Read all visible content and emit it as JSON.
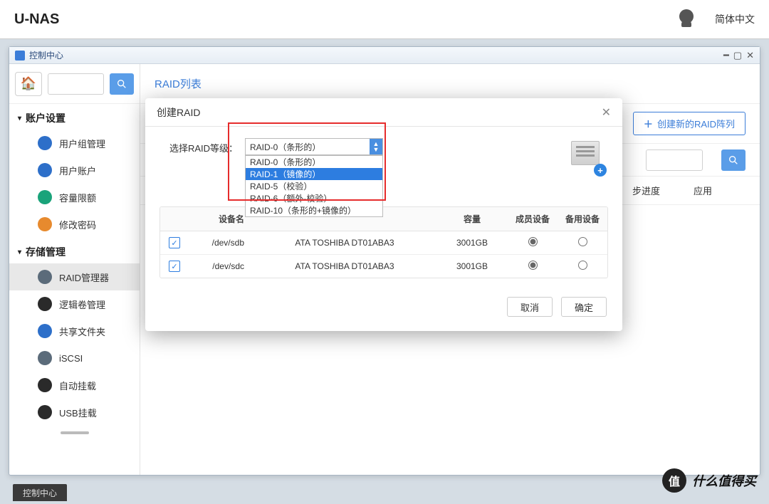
{
  "topbar": {
    "brand": "U-NAS",
    "language": "简体中文"
  },
  "window": {
    "title": "控制中心"
  },
  "sidebar": {
    "groups": [
      {
        "title": "账户设置",
        "items": [
          {
            "label": "用户组管理",
            "color": "#2d6fc9"
          },
          {
            "label": "用户账户",
            "color": "#2d6fc9"
          },
          {
            "label": "容量限额",
            "color": "#1aa37a"
          },
          {
            "label": "修改密码",
            "color": "#e78a2e"
          }
        ]
      },
      {
        "title": "存储管理",
        "items": [
          {
            "label": "RAID管理器",
            "color": "#5b6b7a",
            "active": true
          },
          {
            "label": "逻辑卷管理",
            "color": "#2a2a2a"
          },
          {
            "label": "共享文件夹",
            "color": "#2d6fc9"
          },
          {
            "label": "iSCSI",
            "color": "#5b6b7a"
          },
          {
            "label": "自动挂载",
            "color": "#2a2a2a"
          },
          {
            "label": "USB挂载",
            "color": "#2a2a2a"
          }
        ]
      }
    ]
  },
  "main": {
    "tab": "RAID列表",
    "create_button": "创建新的RAID阵列",
    "columns": {
      "sync": "步进度",
      "app": "应用"
    }
  },
  "modal": {
    "title": "创建RAID",
    "field_label": "选择RAID等级：",
    "selected": "RAID-0（条形的）",
    "options": [
      "RAID-0（条形的）",
      "RAID-1（镜像的）",
      "RAID-5（校验）",
      "RAID-6（额外-校验）",
      "RAID-10（条形的+镜像的）"
    ],
    "hover_index": 1,
    "table": {
      "headers": {
        "name": "设备名",
        "model": "",
        "capacity": "容量",
        "member": "成员设备",
        "spare": "备用设备"
      },
      "rows": [
        {
          "checked": true,
          "name": "/dev/sdb",
          "model": "ATA TOSHIBA DT01ABA3",
          "capacity": "3001GB",
          "member": true,
          "spare": false
        },
        {
          "checked": true,
          "name": "/dev/sdc",
          "model": "ATA TOSHIBA DT01ABA3",
          "capacity": "3001GB",
          "member": true,
          "spare": false
        }
      ]
    },
    "footer": {
      "cancel": "取消",
      "ok": "确定"
    }
  },
  "taskbar": {
    "label": "控制中心"
  },
  "watermark": {
    "badge": "值",
    "text": "什么值得买"
  }
}
